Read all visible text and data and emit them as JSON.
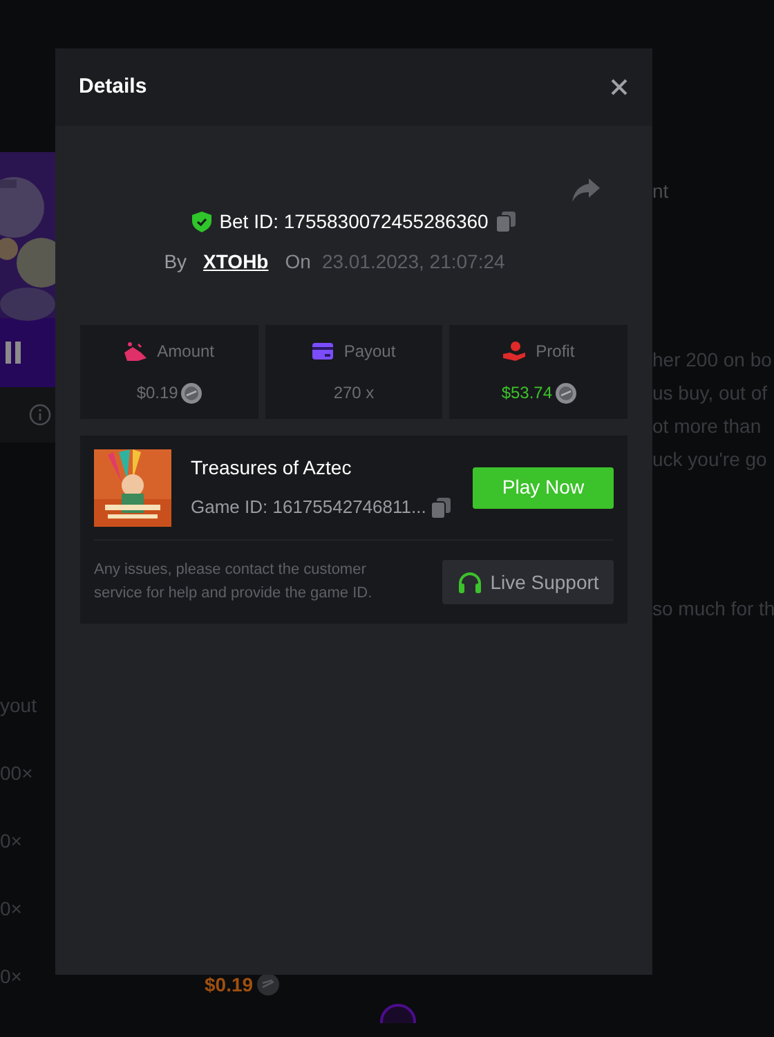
{
  "background": {
    "tab_fragment": "nt",
    "left_labels": [
      "yout",
      "00×",
      "0×",
      "0×",
      "0×"
    ],
    "amount": "$0.19",
    "right_lines": [
      "her 200 on bo",
      "us buy, out of",
      "ot more than",
      "uck you're go",
      "so much for th"
    ]
  },
  "modal": {
    "title": "Details",
    "bet": {
      "id_text": "Bet ID: 1755830072455286360",
      "by_label": "By",
      "user": "XTOHb",
      "on_label": "On",
      "date": "23.01.2023, 21:07:24"
    },
    "stats": [
      {
        "kind": "amount",
        "label": "Amount",
        "value": "$0.19"
      },
      {
        "kind": "payout",
        "label": "Payout",
        "value": "270 x"
      },
      {
        "kind": "profit",
        "label": "Profit",
        "value": "$53.74"
      }
    ],
    "game": {
      "title": "Treasures of Aztec",
      "game_id": "Game ID: 16175542746811...",
      "play_button": "Play Now",
      "note": "Any issues, please contact the customer service for help and provide the game ID.",
      "support_button": "Live Support"
    }
  }
}
